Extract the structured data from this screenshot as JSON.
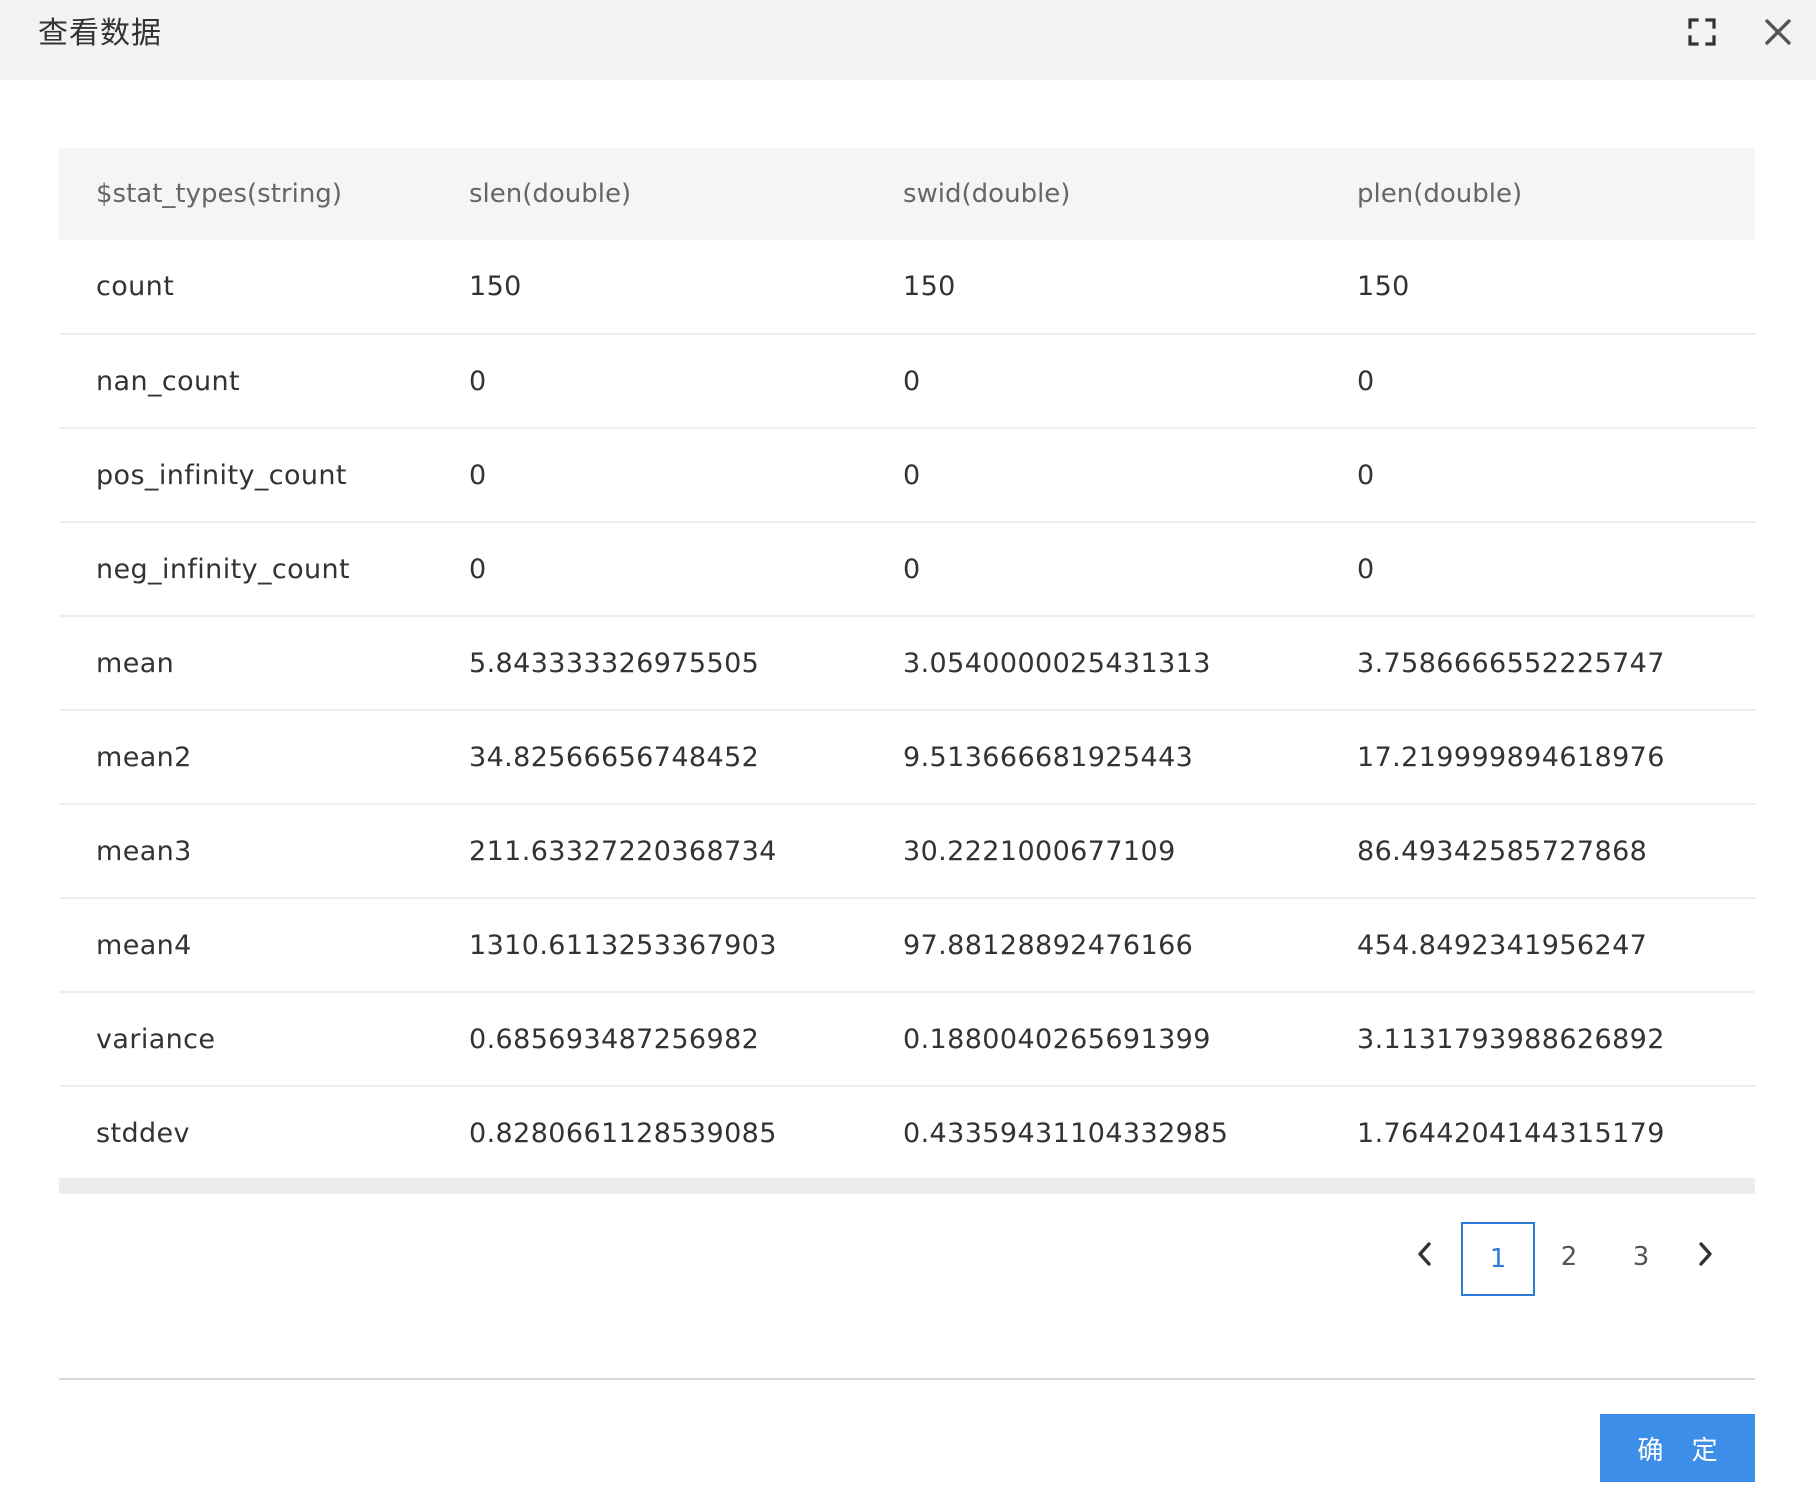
{
  "dialog": {
    "title": "查看数据",
    "ok_label": "确 定"
  },
  "table": {
    "columns": [
      "$stat_types(string)",
      "slen(double)",
      "swid(double)",
      "plen(double)"
    ],
    "rows": [
      [
        "count",
        "150",
        "150",
        "150"
      ],
      [
        "nan_count",
        "0",
        "0",
        "0"
      ],
      [
        "pos_infinity_count",
        "0",
        "0",
        "0"
      ],
      [
        "neg_infinity_count",
        "0",
        "0",
        "0"
      ],
      [
        "mean",
        "5.843333326975505",
        "3.0540000025431313",
        "3.7586666552225747"
      ],
      [
        "mean2",
        "34.82566656748452",
        "9.513666681925443",
        "17.219999894618976"
      ],
      [
        "mean3",
        "211.63327220368734",
        "30.2221000677109",
        "86.49342585727868"
      ],
      [
        "mean4",
        "1310.6113253367903",
        "97.88128892476166",
        "454.8492341956247"
      ],
      [
        "variance",
        "0.685693487256982",
        "0.1880040265691399",
        "3.1131793988626892"
      ],
      [
        "stddev",
        "0.8280661128539085",
        "0.43359431104332985",
        "1.7644204144315179"
      ]
    ]
  },
  "pagination": {
    "pages": [
      "1",
      "2",
      "3"
    ],
    "current": "1"
  },
  "icons": {
    "fullscreen": "fullscreen-icon",
    "close": "close-icon",
    "prev": "chevron-left-icon",
    "next": "chevron-right-icon"
  },
  "colors": {
    "accent": "#3d8ee8",
    "active_page_border": "#2f7bd8",
    "header_bg": "#f3f3f3"
  }
}
